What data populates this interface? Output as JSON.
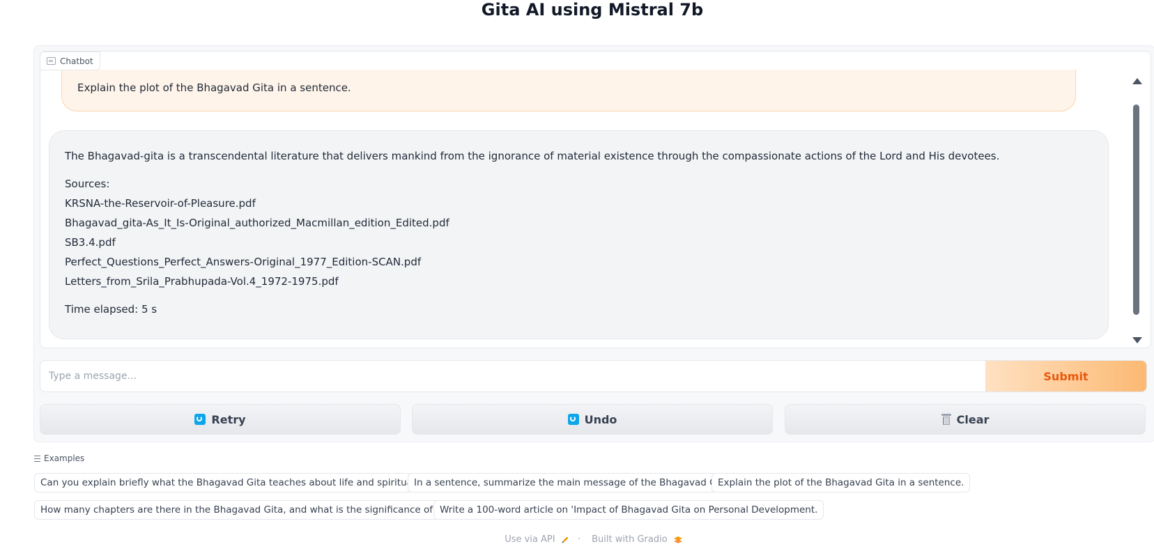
{
  "page": {
    "title": "Gita AI using Mistral 7b"
  },
  "chatbot": {
    "label": "Chatbot",
    "user_message": "Explain the plot of the Bhagavad Gita in a sentence.",
    "bot_message": {
      "answer": "The Bhagavad-gita is a transcendental literature that delivers mankind from the ignorance of material existence through the compassionate actions of the Lord and His devotees.",
      "sources_label": "Sources:",
      "sources": [
        "KRSNA-the-Reservoir-of-Pleasure.pdf",
        "Bhagavad_gita-As_It_Is-Original_authorized_Macmillan_edition_Edited.pdf",
        "SB3.4.pdf",
        "Perfect_Questions_Perfect_Answers-Original_1977_Edition-SCAN.pdf",
        "Letters_from_Srila_Prabhupada-Vol.4_1972-1975.pdf"
      ],
      "time_elapsed": "Time elapsed: 5 s"
    }
  },
  "input": {
    "placeholder": "Type a message...",
    "value": ""
  },
  "buttons": {
    "submit": "Submit",
    "retry": "Retry",
    "undo": "Undo",
    "clear": "Clear"
  },
  "examples": {
    "label": "Examples",
    "items": [
      "Can you explain briefly what the Bhagavad Gita teaches about life and spirituality?",
      "In a sentence, summarize the main message of the Bhagavad Gita.",
      "Explain the plot of the Bhagavad Gita in a sentence.",
      "How many chapters are there in the Bhagavad Gita, and what is the significance of each?",
      "Write a 100-word article on 'Impact of Bhagavad Gita on Personal Development."
    ]
  },
  "footer": {
    "api_link": "Use via API",
    "separator": "·",
    "built_with": "Built with Gradio"
  },
  "colors": {
    "accent": "#ea580c",
    "submit_gradient_start": "#ffe1c2",
    "submit_gradient_end": "#fcb973",
    "user_bubble": "#fff4ea",
    "bot_bubble": "#f3f4f6"
  }
}
